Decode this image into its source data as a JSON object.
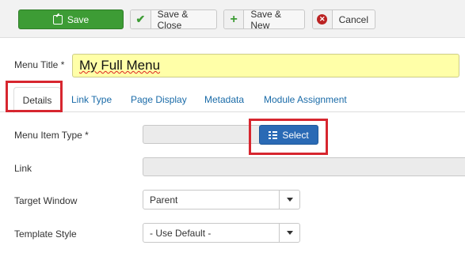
{
  "toolbar": {
    "save_label": "Save",
    "save_close_label": "Save & Close",
    "save_new_label": "Save & New",
    "cancel_label": "Cancel",
    "save_icon": "edit-icon",
    "save_close_icon": "check-icon",
    "save_new_icon": "plus-icon",
    "cancel_icon": "close-circle-icon"
  },
  "menu_title": {
    "label": "Menu Title *",
    "value": "My Full Menu",
    "highlight_color": "#ffffa8"
  },
  "tabs": [
    {
      "label": "Details",
      "active": true
    },
    {
      "label": "Link Type"
    },
    {
      "label": "Page Display"
    },
    {
      "label": "Metadata"
    },
    {
      "label": "Module Assignment"
    }
  ],
  "form": {
    "menu_item_type": {
      "label": "Menu Item Type *",
      "value": "",
      "button_label": "Select",
      "button_icon": "list-icon"
    },
    "link": {
      "label": "Link",
      "value": ""
    },
    "target_window": {
      "label": "Target Window",
      "value": "Parent"
    },
    "template_style": {
      "label": "Template Style",
      "value": "- Use Default -"
    }
  },
  "colors": {
    "save_green": "#3d9c35",
    "select_blue": "#2a6ab5",
    "annotation_red": "#d7262f",
    "tab_link": "#1a6ba8"
  }
}
